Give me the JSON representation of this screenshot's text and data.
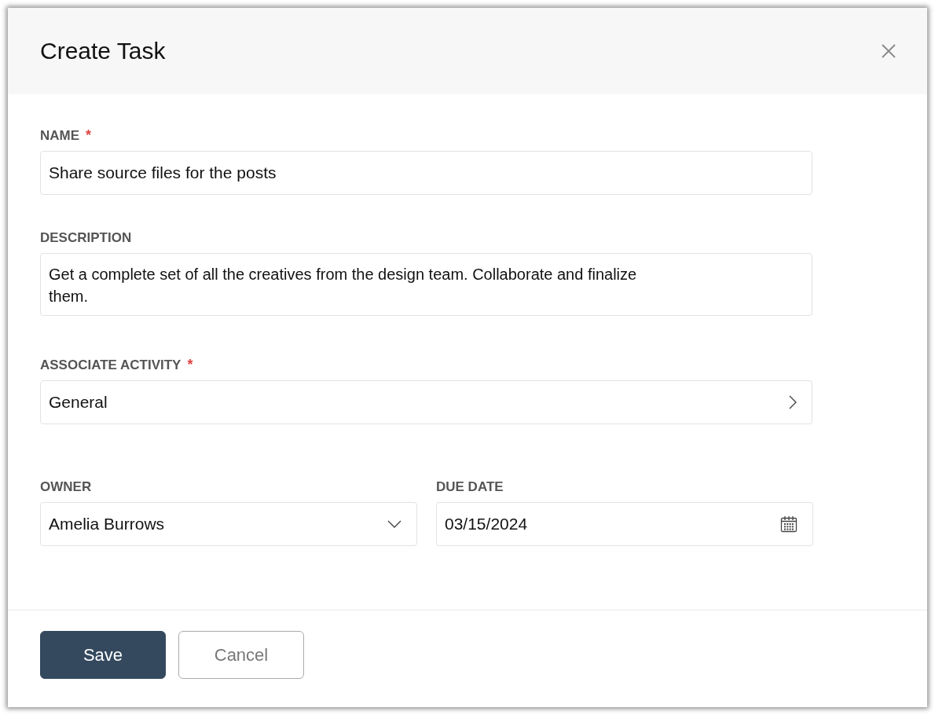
{
  "dialog": {
    "title": "Create Task"
  },
  "fields": [
    {
      "kind": "text",
      "label": "NAME",
      "required_mark": "*",
      "value": "Share source files for the posts"
    },
    {
      "kind": "textarea",
      "label": "DESCRIPTION",
      "value": "Get a complete set of all the creatives from the design team. Collaborate and finalize them."
    },
    {
      "kind": "picker",
      "label": "ASSOCIATE ACTIVITY",
      "required_mark": "*",
      "value": "General"
    }
  ],
  "split_fields": [
    {
      "kind": "dropdown",
      "label": "OWNER",
      "value": "Amelia Burrows"
    },
    {
      "kind": "date",
      "label": "DUE DATE",
      "value": "03/15/2024"
    }
  ],
  "buttons": [
    {
      "kind": "primary",
      "label": "Save"
    },
    {
      "kind": "secondary",
      "label": "Cancel"
    }
  ]
}
